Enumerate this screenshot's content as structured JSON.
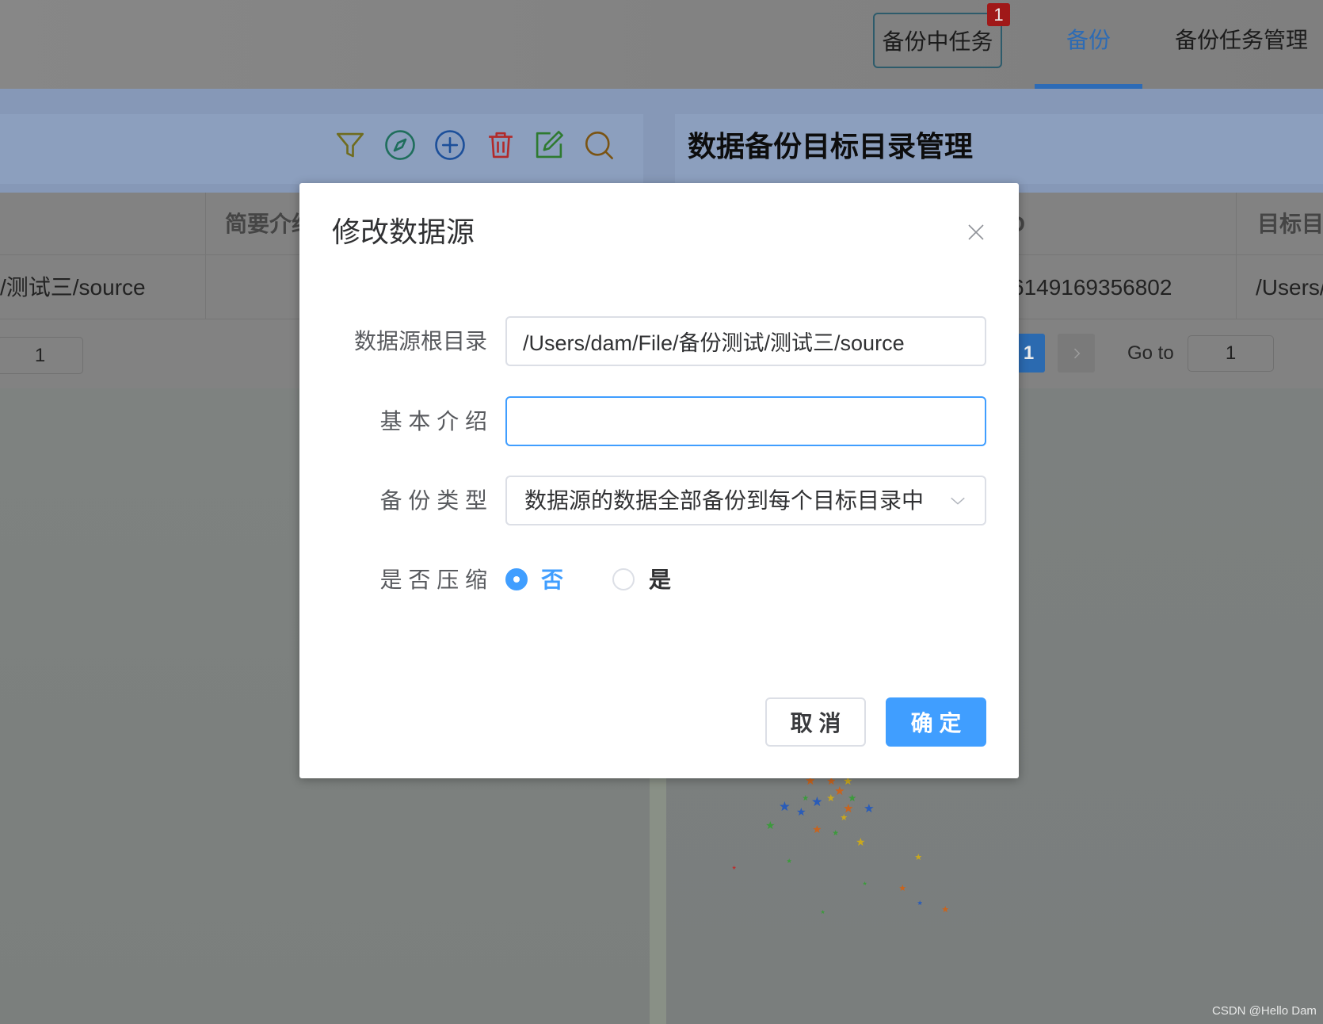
{
  "top_nav": {
    "tasks_in_progress_label": "备份中任务",
    "tasks_badge": "1",
    "backup_tab": "备份",
    "task_management_tab": "备份任务管理",
    "active_tab": "备份"
  },
  "left_panel": {
    "toolbar_icons": [
      "filter-icon",
      "compass-icon",
      "plus-circle-icon",
      "trash-icon",
      "edit-icon",
      "search-icon"
    ],
    "table": {
      "headers": [
        "简要介绍"
      ],
      "rows": [
        [
          "/测试三/source"
        ]
      ]
    },
    "pagination": {
      "goto_value": "1"
    }
  },
  "right_panel": {
    "title": "数据备份目标目录管理",
    "table": {
      "headers": [
        "ID",
        "目标目"
      ],
      "rows": [
        [
          "6149169356802",
          "/Users/"
        ]
      ]
    },
    "pagination": {
      "current_page": "1",
      "next_icon": "chevron-right-icon",
      "goto_label": "Go to",
      "goto_value": "1"
    }
  },
  "dialog": {
    "title": "修改数据源",
    "close_icon": "close-icon",
    "fields": {
      "root_dir": {
        "label": "数据源根目录",
        "value": "/Users/dam/File/备份测试/测试三/source"
      },
      "description": {
        "label": "基 本 介 绍",
        "value": ""
      },
      "backup_type": {
        "label": "备 份 类 型",
        "value": "数据源的数据全部备份到每个目标目录中",
        "icon": "chevron-down-icon"
      },
      "compress": {
        "label": "是 否 压 缩",
        "options": [
          "否",
          "是"
        ],
        "selected": "否"
      }
    },
    "cancel_label": "取 消",
    "confirm_label": "确 定"
  },
  "watermark": "CSDN @Hello Dam",
  "colors": {
    "primary": "#409eff",
    "badge": "#a01818",
    "overlay_tint": "#808080"
  }
}
